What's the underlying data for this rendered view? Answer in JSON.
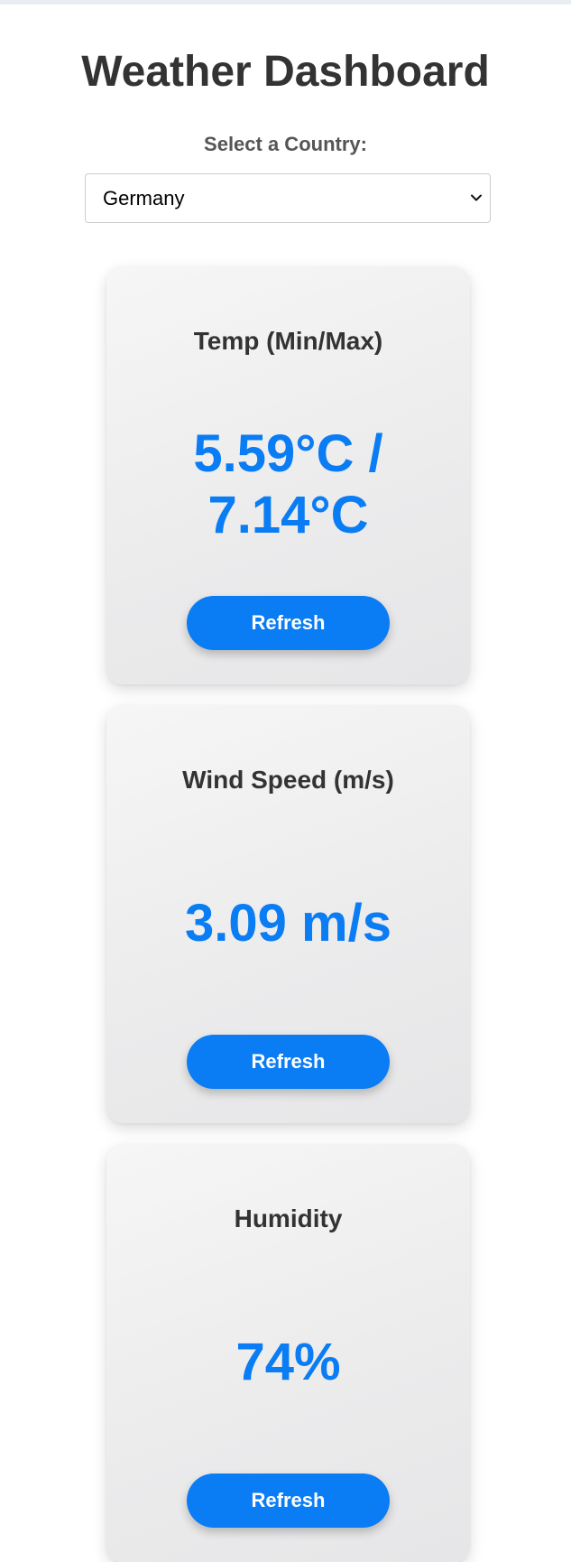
{
  "page": {
    "title": "Weather Dashboard"
  },
  "selector": {
    "label": "Select a Country:",
    "value": "Germany"
  },
  "cards": [
    {
      "title": "Temp (Min/Max)",
      "value": "5.59°C / 7.14°C",
      "button": "Refresh"
    },
    {
      "title": "Wind Speed (m/s)",
      "value": "3.09 m/s",
      "button": "Refresh"
    },
    {
      "title": "Humidity",
      "value": "74%",
      "button": "Refresh"
    }
  ],
  "colors": {
    "accent": "#0a7cf4",
    "heading": "#333333",
    "label": "#555555",
    "card_background": "#efefef"
  },
  "icons": {
    "select_arrow": "chevron-down-icon"
  }
}
